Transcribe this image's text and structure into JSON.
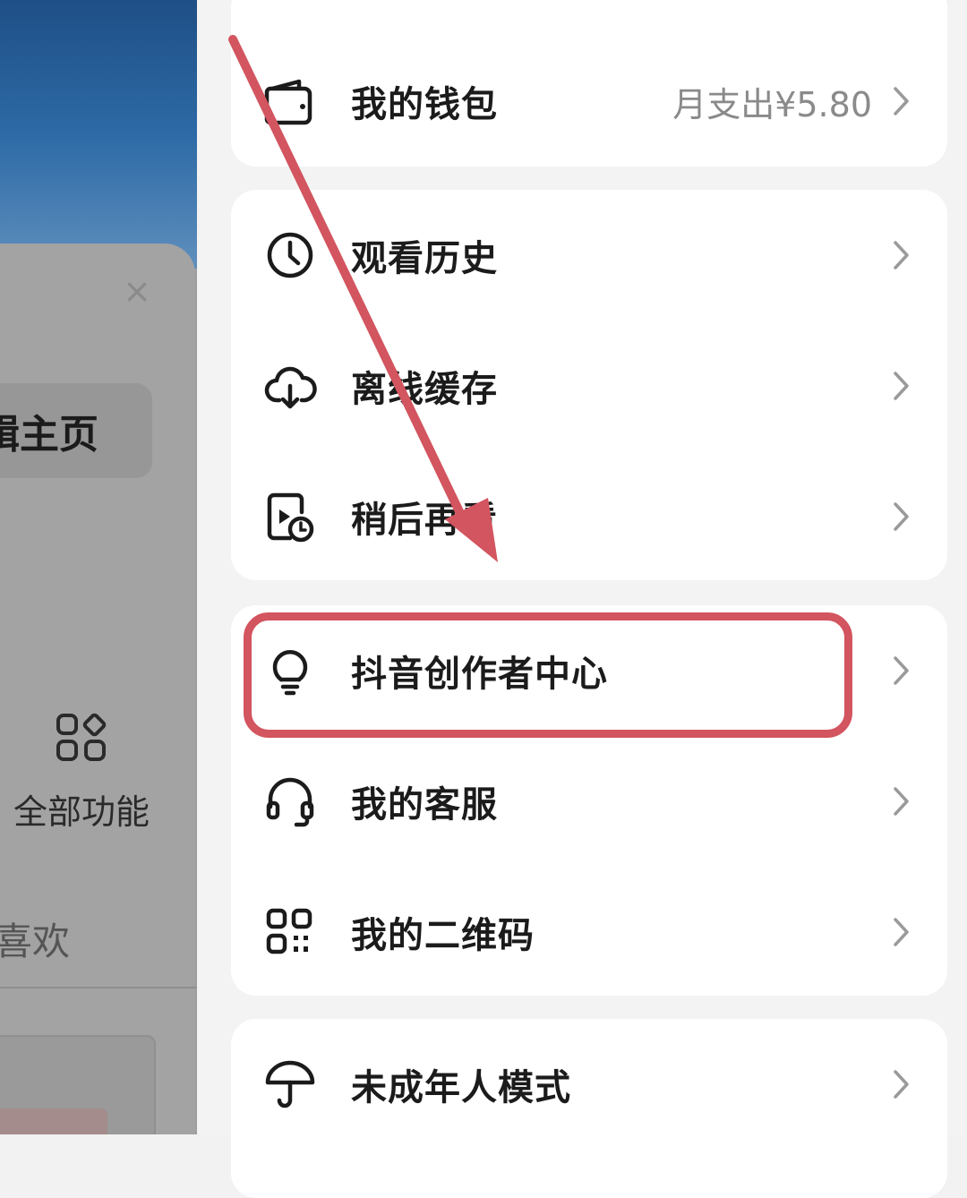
{
  "left": {
    "close_symbol": "×",
    "home_button": "辑主页",
    "all_functions": "全部功能",
    "likes": "喜欢"
  },
  "menu": {
    "wallet": {
      "label": "我的钱包",
      "value": "月支出¥5.80"
    },
    "history": {
      "label": "观看历史"
    },
    "offline": {
      "label": "离线缓存"
    },
    "watch_later": {
      "label": "稍后再看"
    },
    "creator_center": {
      "label": "抖音创作者中心"
    },
    "customer_service": {
      "label": "我的客服"
    },
    "qr_code": {
      "label": "我的二维码"
    },
    "minor_mode": {
      "label": "未成年人模式"
    }
  },
  "annotation": {
    "color": "#d2555f"
  }
}
